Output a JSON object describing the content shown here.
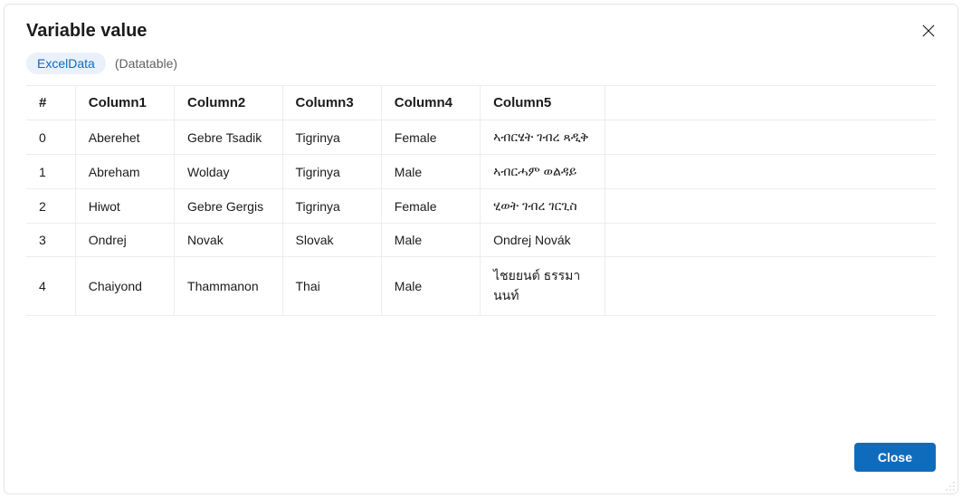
{
  "dialog": {
    "title": "Variable value",
    "variable_name": "ExcelData",
    "variable_type": "(Datatable)",
    "close_button_label": "Close"
  },
  "table": {
    "columns": [
      "#",
      "Column1",
      "Column2",
      "Column3",
      "Column4",
      "Column5"
    ],
    "rows": [
      {
        "index": "0",
        "c1": "Aberehet",
        "c2": "Gebre Tsadik",
        "c3": "Tigrinya",
        "c4": "Female",
        "c5": "ኣብርሄት ገብረ ጻዲቅ"
      },
      {
        "index": "1",
        "c1": "Abreham",
        "c2": "Wolday",
        "c3": "Tigrinya",
        "c4": "Male",
        "c5": "ኣብርሓም ወልዳይ"
      },
      {
        "index": "2",
        "c1": "Hiwot",
        "c2": "Gebre Gergis",
        "c3": "Tigrinya",
        "c4": "Female",
        "c5": "ሂወት ገብረ ገርጊስ"
      },
      {
        "index": "3",
        "c1": "Ondrej",
        "c2": "Novak",
        "c3": "Slovak",
        "c4": "Male",
        "c5": "Ondrej Novák"
      },
      {
        "index": "4",
        "c1": "Chaiyond",
        "c2": "Thammanon",
        "c3": "Thai",
        "c4": "Male",
        "c5": "ไชยยนต์ ธรรมานนท์"
      }
    ]
  }
}
